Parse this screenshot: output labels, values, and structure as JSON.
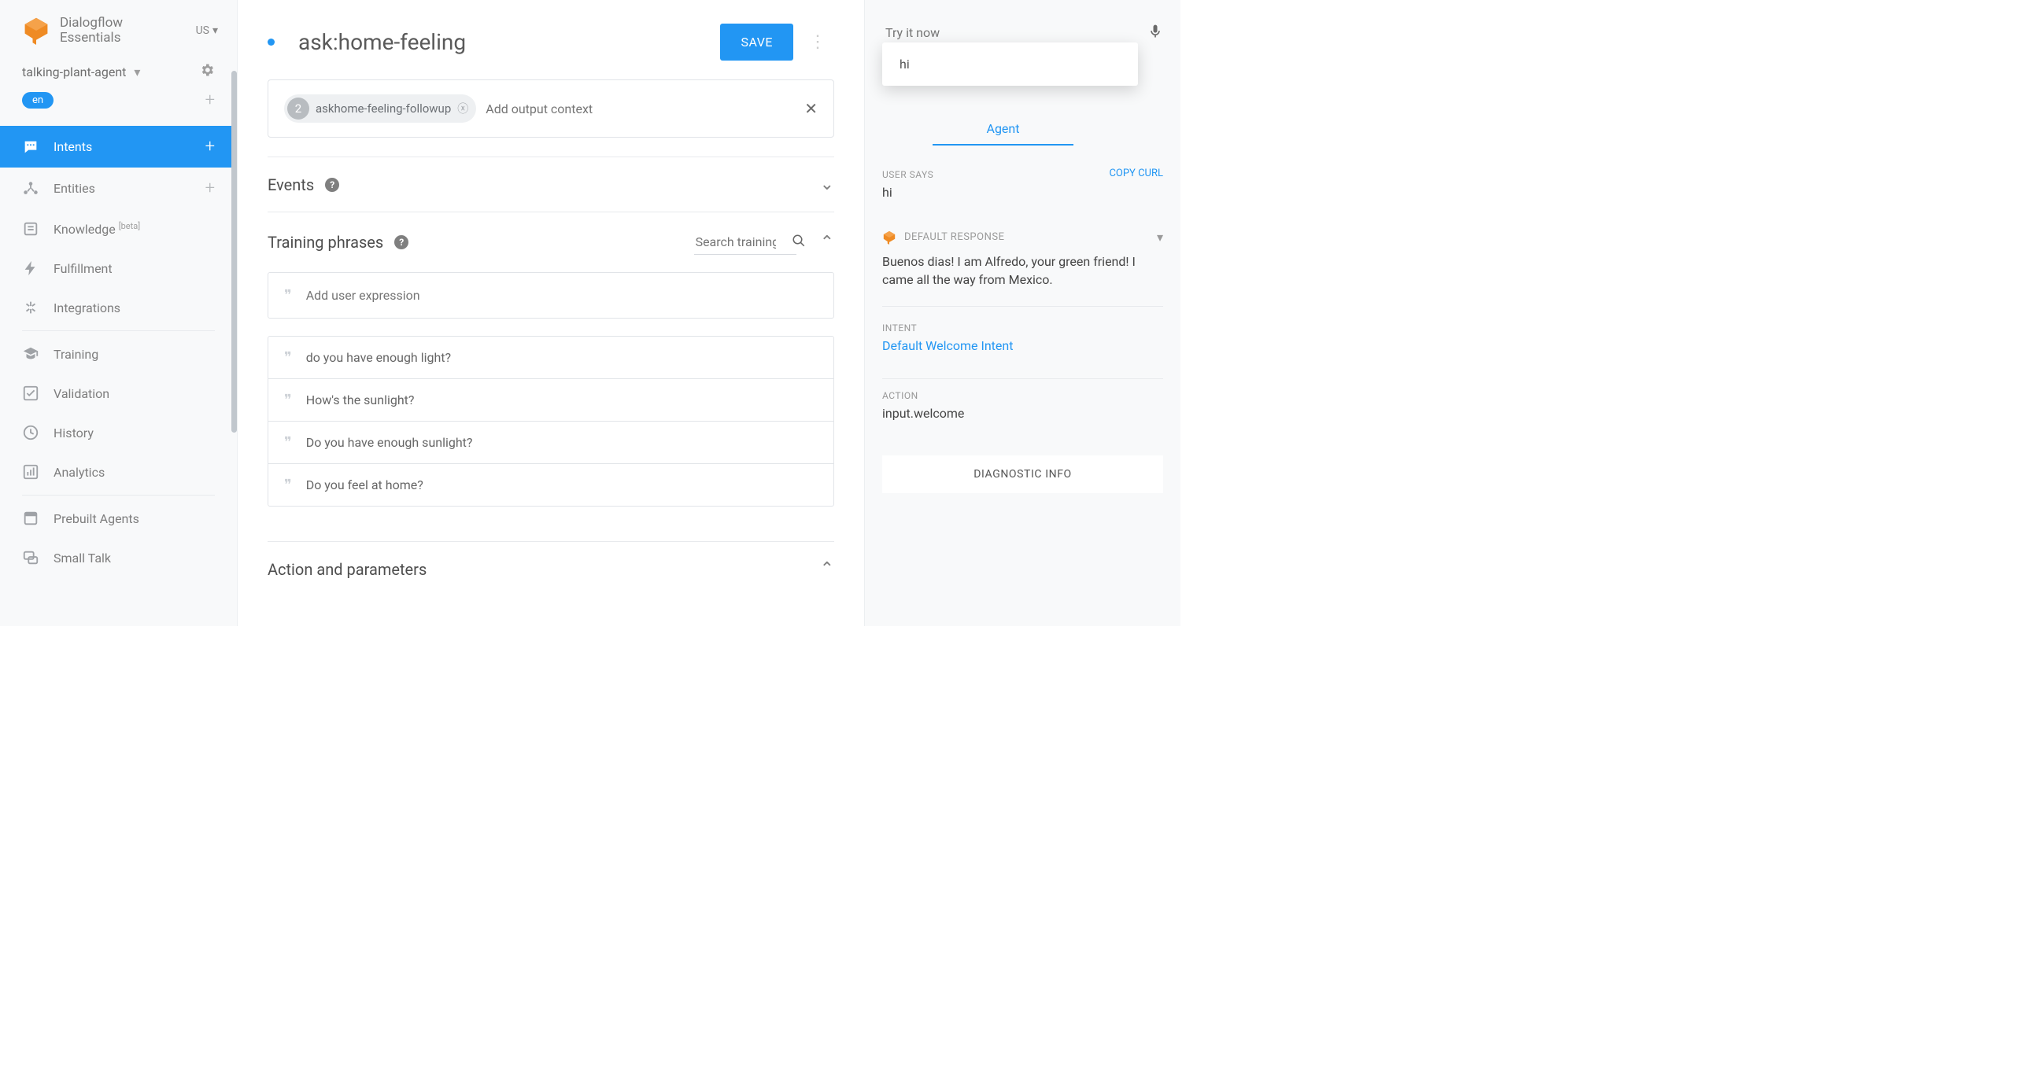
{
  "brand": {
    "line1": "Dialogflow",
    "line2": "Essentials",
    "region": "US"
  },
  "agent": {
    "name": "talking-plant-agent",
    "language": "en"
  },
  "nav": {
    "intents": "Intents",
    "entities": "Entities",
    "knowledge": "Knowledge",
    "knowledge_beta": "[beta]",
    "fulfillment": "Fulfillment",
    "integrations": "Integrations",
    "training": "Training",
    "validation": "Validation",
    "history": "History",
    "analytics": "Analytics",
    "prebuilt": "Prebuilt Agents",
    "smalltalk": "Small Talk"
  },
  "intent": {
    "title": "ask:home-feeling",
    "save": "SAVE",
    "context": {
      "count": "2",
      "name": "askhome-feeling-followup",
      "add_placeholder": "Add output context"
    },
    "events": "Events",
    "training": {
      "title": "Training phrases",
      "search_placeholder": "Search training ph",
      "add_placeholder": "Add user expression",
      "phrases": [
        "do you have enough light?",
        "How's the sunlight?",
        "Do you have enough sunlight?",
        "Do you feel at home?"
      ]
    },
    "action_section": "Action and parameters"
  },
  "try": {
    "placeholder": "Try it now",
    "popup": "hi",
    "tab": "Agent",
    "user_says_label": "USER SAYS",
    "copy": "COPY CURL",
    "user_says": "hi",
    "default_resp_label": "DEFAULT RESPONSE",
    "response": "Buenos dias! I am Alfredo, your green friend! I came all the way from Mexico.",
    "intent_label": "INTENT",
    "intent_name": "Default Welcome Intent",
    "action_label": "ACTION",
    "action": "input.welcome",
    "diag": "DIAGNOSTIC INFO"
  }
}
